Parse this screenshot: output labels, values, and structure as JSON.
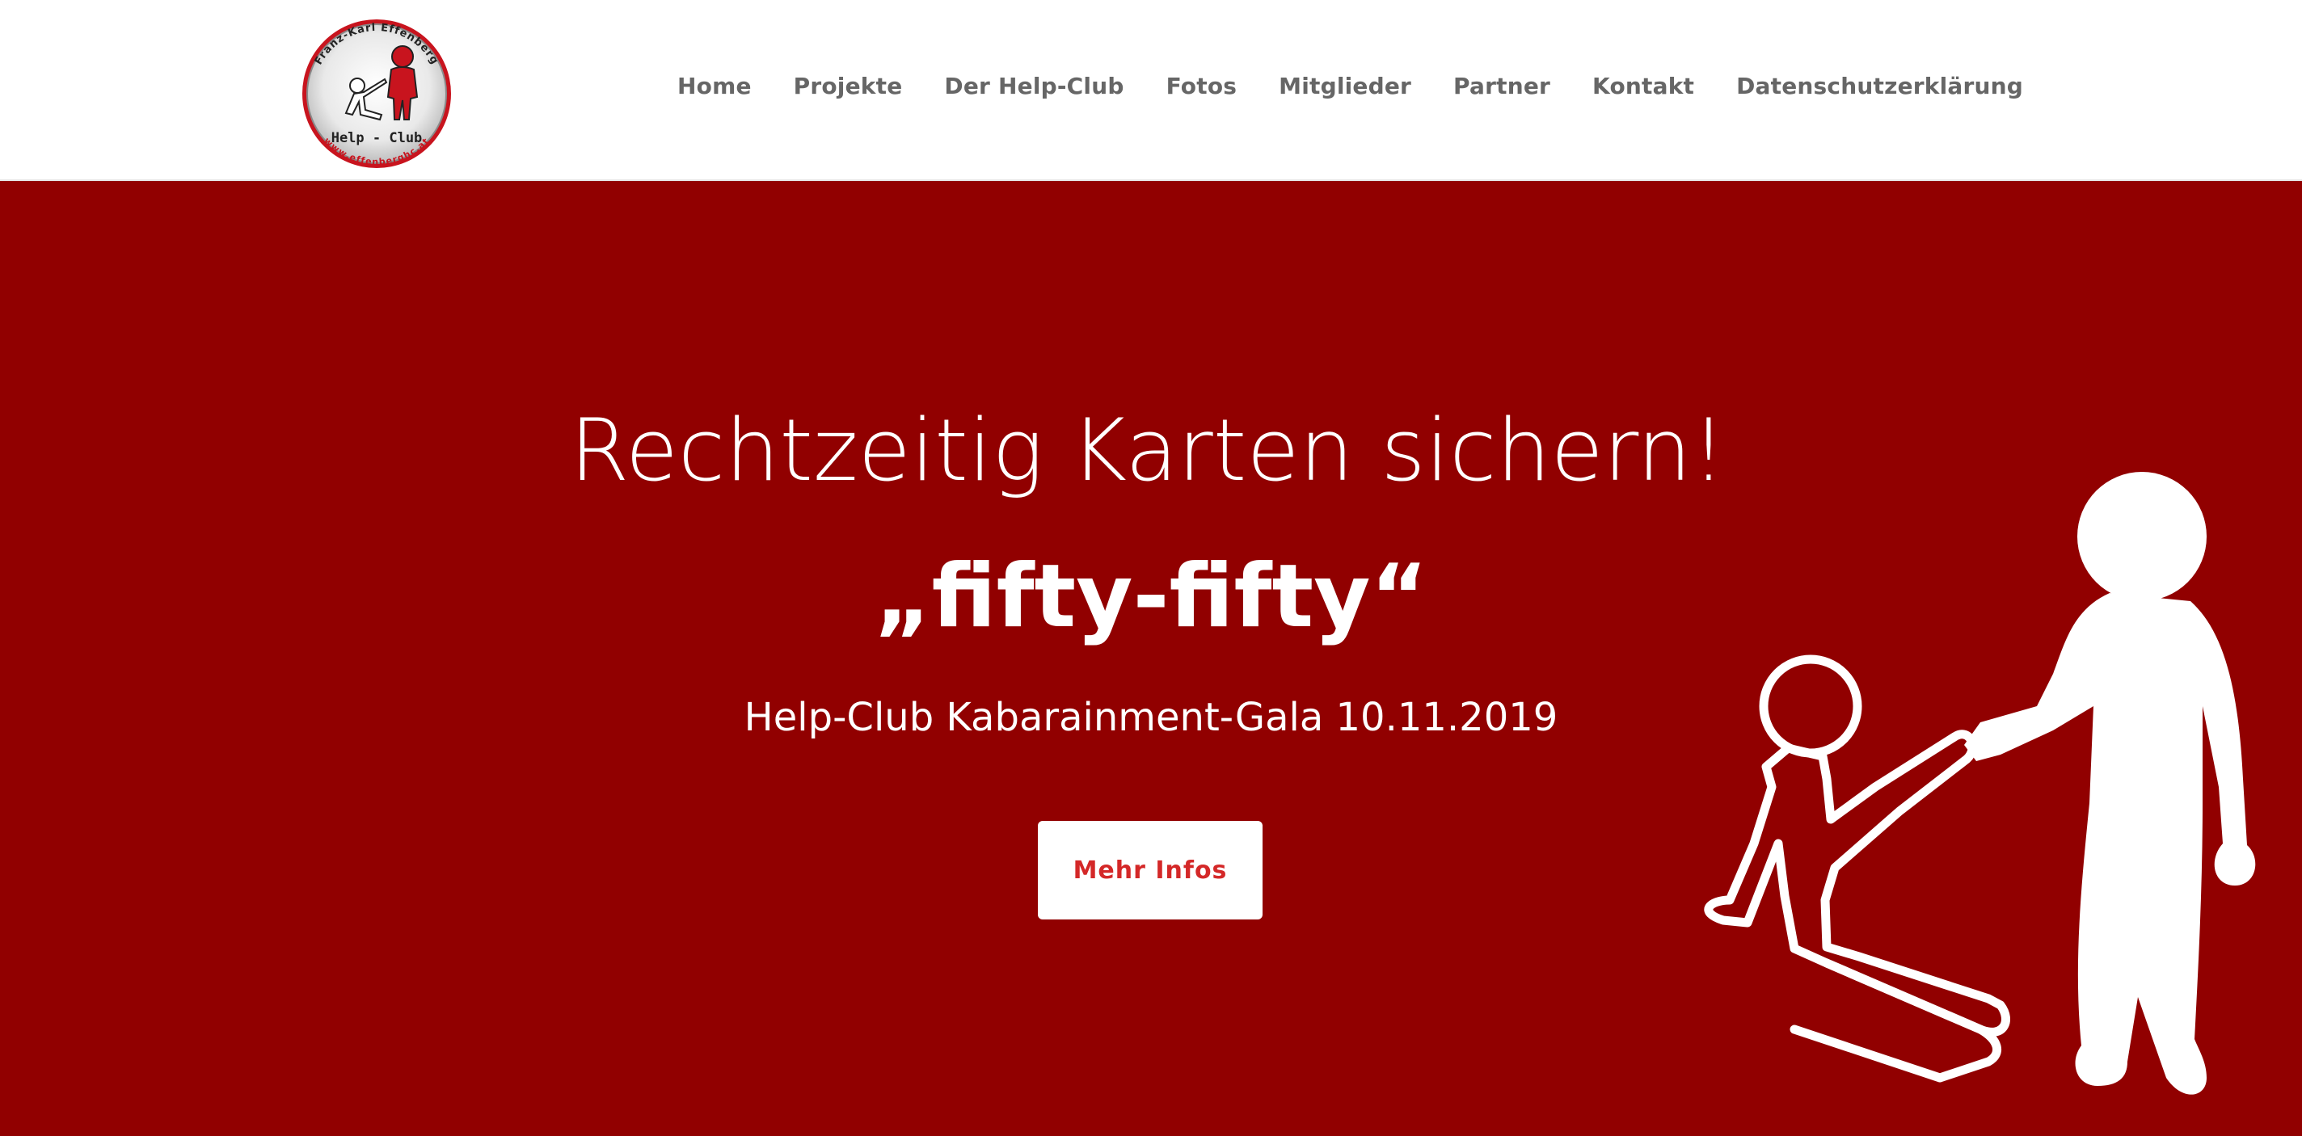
{
  "header": {
    "logo": {
      "name": "logo-effenberg-help-club",
      "arc_text": "Franz-Karl Effenberg",
      "center_text": "Help - Club",
      "url_text": "www.effenberghc.at"
    },
    "nav": [
      {
        "label": "Home"
      },
      {
        "label": "Projekte"
      },
      {
        "label": "Der Help-Club"
      },
      {
        "label": "Fotos"
      },
      {
        "label": "Mitglieder"
      },
      {
        "label": "Partner"
      },
      {
        "label": "Kontakt"
      },
      {
        "label": "Datenschutzerklärung"
      }
    ]
  },
  "hero": {
    "headline": "Rechtzeitig Karten sichern!",
    "title": "„fifty-fifty“",
    "subtitle": "Help-Club Kabarainment-Gala 10.11.2019",
    "button_label": "Mehr Infos",
    "illustration": "helping-hand-figures-icon"
  },
  "colors": {
    "hero_background": "#910000",
    "nav_text": "#666666",
    "button_text": "#d42828",
    "logo_red": "#c8141e"
  }
}
